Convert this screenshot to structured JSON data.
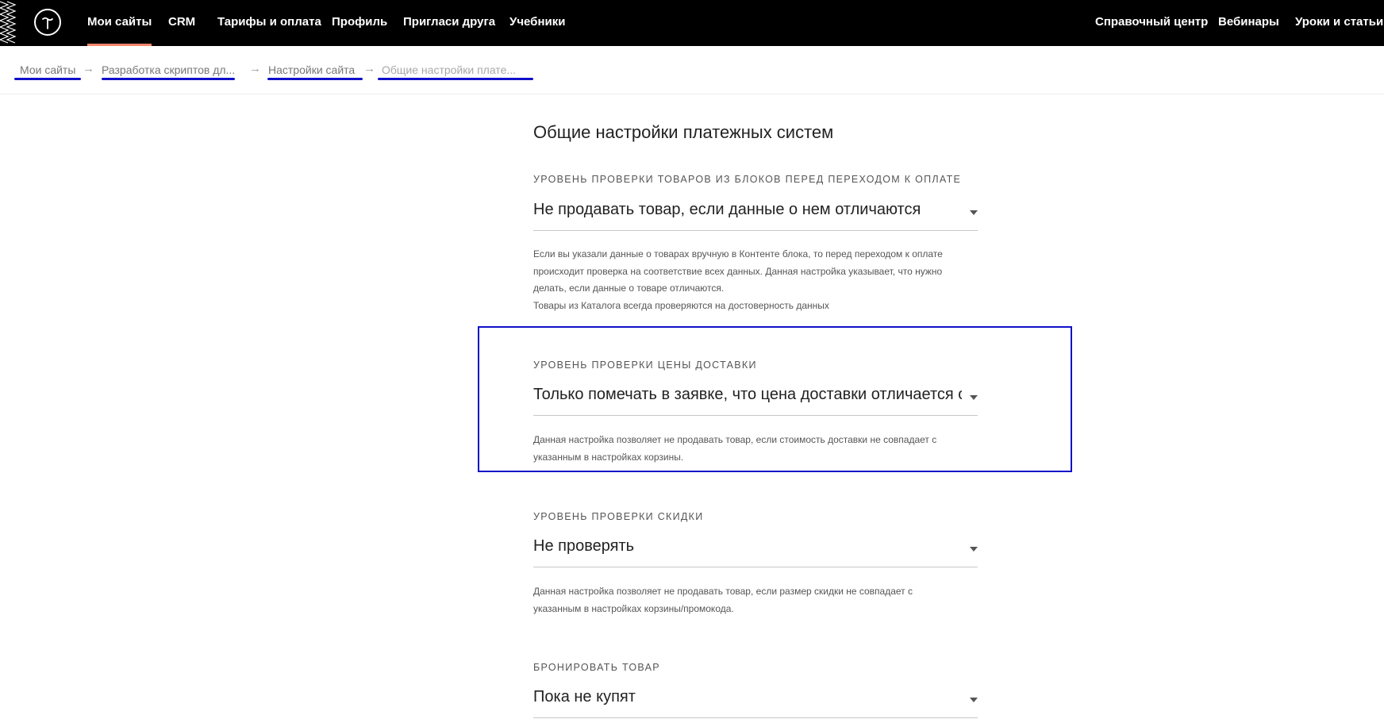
{
  "nav": {
    "items": [
      {
        "label": "Мои сайты",
        "active": true
      },
      {
        "label": "CRM",
        "active": false
      },
      {
        "label": "Тарифы и оплата",
        "active": false
      },
      {
        "label": "Профиль",
        "active": false
      },
      {
        "label": "Пригласи друга",
        "active": false
      },
      {
        "label": "Учебники",
        "active": false
      }
    ],
    "right_items": [
      {
        "label": "Справочный центр"
      },
      {
        "label": "Вебинары"
      },
      {
        "label": "Уроки и статьи"
      }
    ],
    "accent_color": "#fa876b"
  },
  "breadcrumbs": {
    "items": [
      {
        "label": "Мои сайты"
      },
      {
        "label": "Разработка скриптов дл..."
      },
      {
        "label": "Настройки сайта"
      },
      {
        "label": "Общие настройки плате..."
      }
    ],
    "separator": "→"
  },
  "page": {
    "title": "Общие настройки платежных систем"
  },
  "sections": [
    {
      "label": "Уровень проверки товаров из блоков перед переходом к оплате",
      "value": "Не продавать товар, если данные о нем отличаются",
      "hint": [
        "Если вы указали данные о товарах вручную в Контенте блока, то перед переходом к оплате",
        "происходит проверка на соответствие всех данных. Данная настройка указывает, что нужно",
        "делать, если данные о товаре отличаются.",
        "Товары из Каталога всегда проверяются на достоверность данных"
      ]
    },
    {
      "label": "Уровень проверки цены доставки",
      "value": "Только помечать в заявке, что цена доставки отличается от",
      "hint": [
        "Данная настройка позволяет не продавать товар, если стоимость доставки не совпадает с",
        "указанным в настройках корзины."
      ]
    },
    {
      "label": "Уровень проверки скидки",
      "value": "Не проверять",
      "hint": [
        "Данная настройка позволяет не продавать товар, если размер скидки не совпадает с",
        "указанным в настройках корзины/промокода."
      ]
    },
    {
      "label": "Бронировать товар",
      "value": "Пока не купят"
    }
  ],
  "annotation_color": "#1010c8"
}
